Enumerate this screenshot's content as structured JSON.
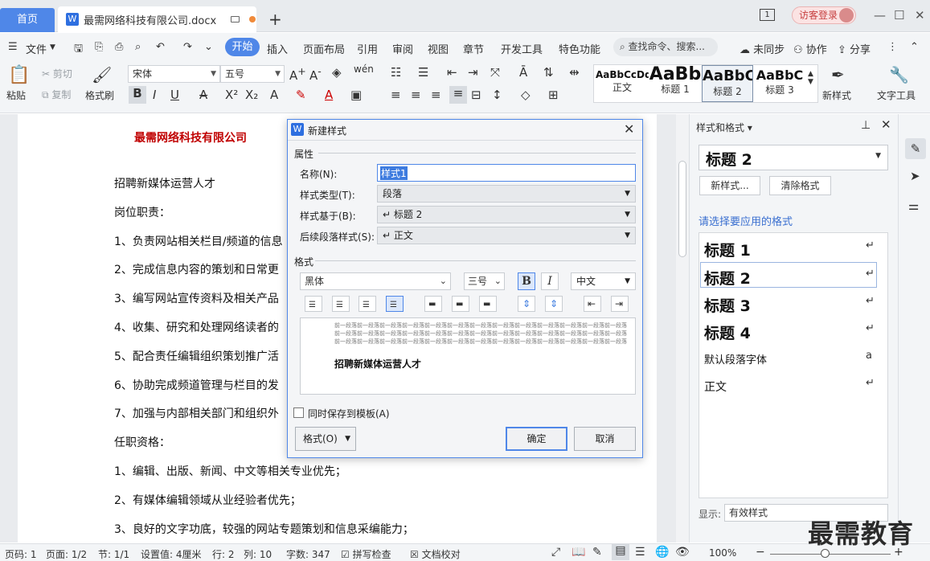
{
  "titlebar": {
    "home_tab": "首页",
    "doc_tab": "最需网络科技有限公司.docx",
    "new_tab": "+",
    "page_badge": "1",
    "login": "访客登录",
    "min": "—",
    "max": "☐",
    "close": "✕"
  },
  "menu": {
    "file": "文件",
    "items": [
      "开始",
      "插入",
      "页面布局",
      "引用",
      "审阅",
      "视图",
      "章节",
      "开发工具",
      "特色功能"
    ],
    "search": "查找命令、搜索...",
    "sync": "未同步",
    "collab": "协作",
    "share": "分享"
  },
  "ribbon": {
    "paste": "粘贴",
    "cut": "剪切",
    "copy": "复制",
    "format_painter": "格式刷",
    "font_name": "宋体",
    "font_size": "五号",
    "styles": [
      {
        "preview": "AaBbCcDd",
        "name": "正文"
      },
      {
        "preview": "AaBb",
        "name": "标题 1"
      },
      {
        "preview": "AaBbC",
        "name": "标题 2"
      },
      {
        "preview": "AaBbC",
        "name": "标题 3"
      }
    ],
    "new_style": "新样式",
    "text_tools": "文字工具"
  },
  "document": {
    "company": "最需网络科技有限公司",
    "lines": [
      "招聘新媒体运营人才",
      "岗位职责：",
      "1、负责网站相关栏目/频道的信息",
      "2、完成信息内容的策划和日常更",
      "3、编写网站宣传资料及相关产品",
      "4、收集、研究和处理网络读者的",
      "5、配合责任编辑组织策划推广活",
      "6、协助完成频道管理与栏目的发",
      "7、加强与内部相关部门和组织外",
      "任职资格：",
      "1、编辑、出版、新闻、中文等相关专业优先；",
      "2、有媒体编辑领域从业经验者优先；",
      "3、良好的文字功底，较强的网站专题策划和信息采编能力；"
    ]
  },
  "dialog": {
    "title": "新建样式",
    "section_props": "属性",
    "name_label": "名称(N):",
    "name_value": "样式1",
    "type_label": "样式类型(T):",
    "type_value": "段落",
    "based_label": "样式基于(B):",
    "based_value": "↵ 标题 2",
    "next_label": "后续段落样式(S):",
    "next_value": "↵ 正文",
    "section_format": "格式",
    "font": "黑体",
    "size": "三号",
    "bold": "B",
    "italic": "I",
    "lang": "中文",
    "preview_text": "招聘新媒体运营人才",
    "preview_filler": "前一段落前一段落前一段落前一段落前一段落前一段落前一段落前一段落前一段落前一段落前一段落前一段落前一段落",
    "save_template": "同时保存到模板(A)",
    "format_btn": "格式(O)",
    "ok": "确定",
    "cancel": "取消"
  },
  "panel": {
    "title": "样式和格式",
    "current": "标题  2",
    "new_style_btn": "新样式...",
    "clear_btn": "清除格式",
    "hint": "请选择要应用的格式",
    "styles": [
      "标题  1",
      "标题  2",
      "标题  3",
      "标题  4",
      "默认段落字体",
      "正文"
    ],
    "show_label": "显示:",
    "show_value": "有效样式"
  },
  "status": {
    "page_num": "页码: 1",
    "page": "页面: 1/2",
    "section": "节: 1/1",
    "setting": "设置值: 4厘米",
    "row": "行: 2",
    "col": "列: 10",
    "words": "字数: 347",
    "spell": "拼写检查",
    "proof": "文档校对",
    "zoom": "100%"
  },
  "watermark": "最需教育"
}
